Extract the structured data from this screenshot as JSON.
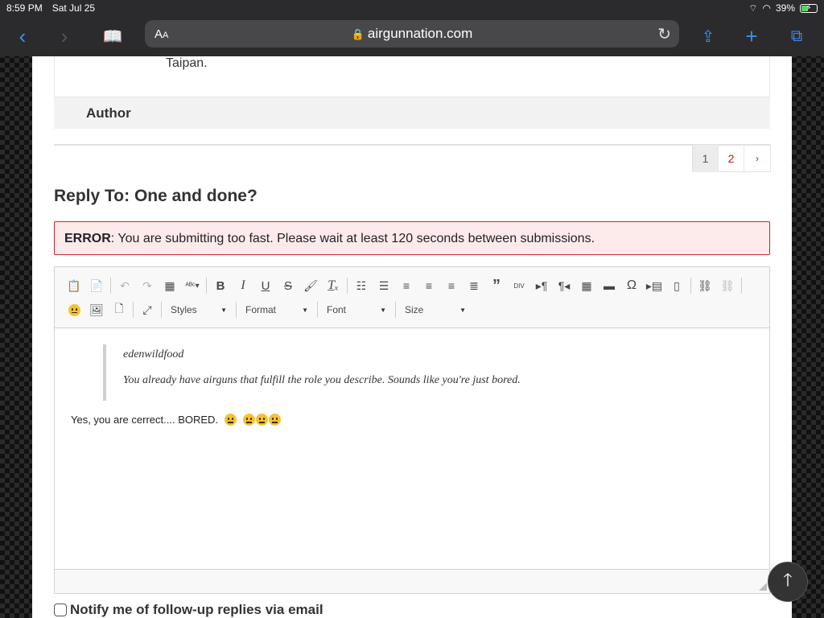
{
  "status_bar": {
    "time": "8:59 PM",
    "date": "Sat Jul 25",
    "battery": "39%"
  },
  "safari": {
    "text_size": "AA",
    "url": "airgunnation.com"
  },
  "previous_reply": {
    "tail_text": "Taipan.",
    "author_label": "Author"
  },
  "pagination": {
    "pages": [
      "1",
      "2"
    ],
    "current": "1",
    "next": "›"
  },
  "reply": {
    "title": "Reply To: One and done?",
    "error_label": "ERROR",
    "error_message": ": You are submitting too fast. Please wait at least 120 seconds between submissions."
  },
  "editor": {
    "combos": {
      "styles": "Styles",
      "format": "Format",
      "font": "Font",
      "size": "Size"
    },
    "quote_author": "edenwildfood",
    "quote_text": "You already have airguns that fulfill the role you describe. Sounds like you're just bored.",
    "body_text": "Yes, you are cerrect.... BORED."
  },
  "notify_label": "Notify me of follow-up replies via email",
  "colors": {
    "error_border": "#c0262c",
    "error_bg": "#fdebeb",
    "link_red": "#a02020",
    "safari_blue": "#3b8ef0"
  }
}
